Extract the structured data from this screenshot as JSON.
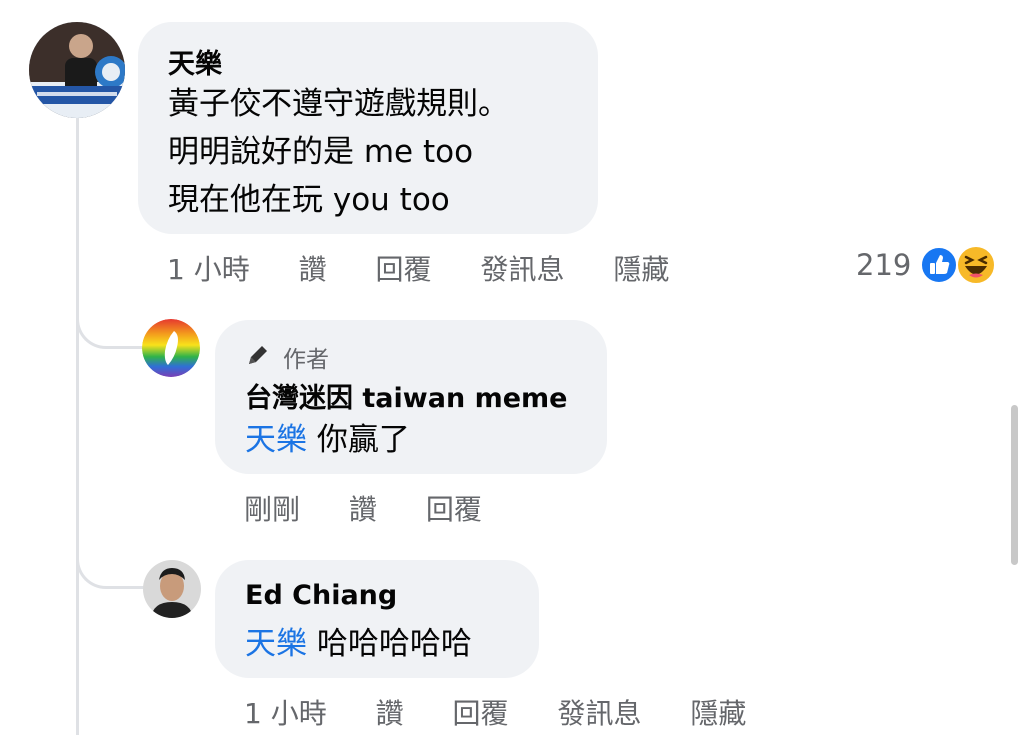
{
  "comments": [
    {
      "author": "天樂",
      "avatar_icon": "profile-photo",
      "lines": [
        "黃子佼不遵守遊戲規則。",
        "明明說好的是 me too",
        "現在他在玩 you too"
      ],
      "time": "1 小時",
      "like": "讚",
      "reply": "回覆",
      "message": "發訊息",
      "hide": "隱藏",
      "reaction_count": "219",
      "reaction_icons": [
        "like-icon",
        "haha-icon"
      ]
    }
  ],
  "replies": [
    {
      "badge_icon": "pencil-icon",
      "badge": "作者",
      "author": "台灣迷因 taiwan meme",
      "mention": "天樂",
      "text": "你贏了",
      "time": "剛剛",
      "like": "讚",
      "reply": "回覆"
    },
    {
      "author": "Ed Chiang",
      "mention": "天樂",
      "text": "哈哈哈哈哈",
      "time": "1 小時",
      "like": "讚",
      "reply": "回覆",
      "message": "發訊息",
      "hide": "隱藏"
    }
  ],
  "colors": {
    "bubble": "#f0f2f5",
    "meta": "#65676b",
    "mention": "#1b74e4",
    "like": "#1877f2",
    "haha": "#f7b928"
  }
}
